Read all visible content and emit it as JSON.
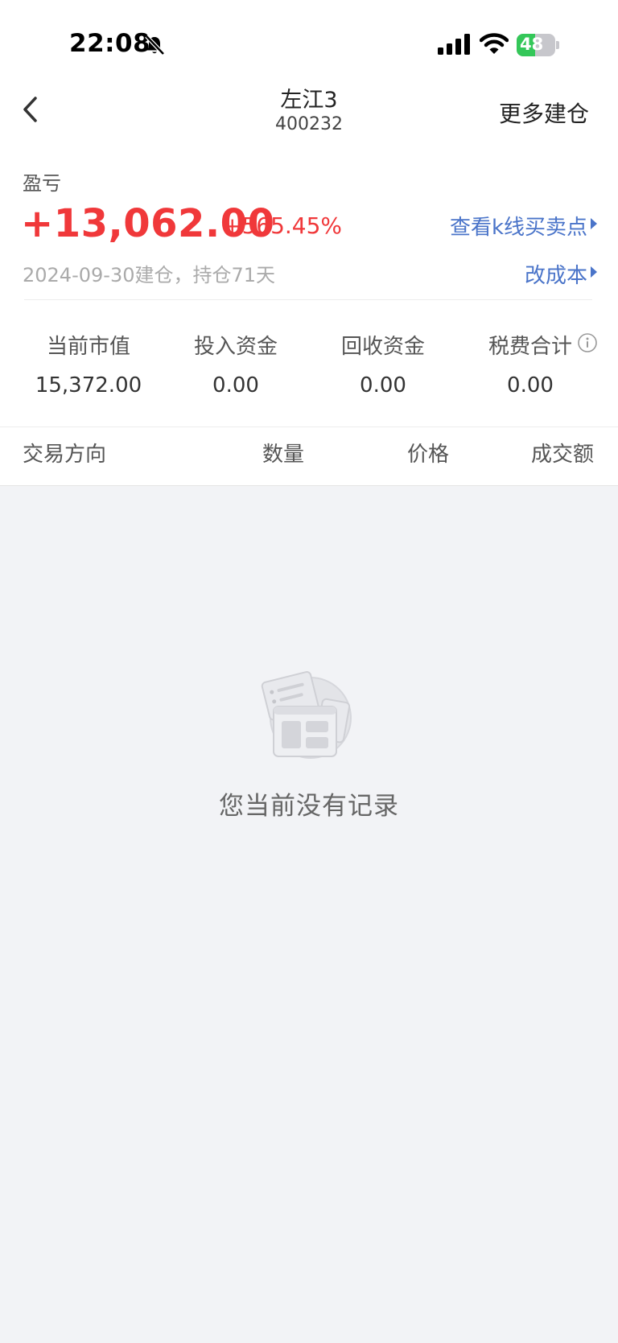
{
  "status_bar": {
    "time": "22:08",
    "battery": "48",
    "battery_level": 0.48
  },
  "nav": {
    "title": "左江3",
    "code": "400232",
    "more": "更多建仓"
  },
  "pnl": {
    "label": "盈亏",
    "value": "+13,062.00",
    "percent": "+565.45%",
    "kline_link": "查看k线买卖点",
    "date_info": "2024-09-30建仓，持仓71天",
    "cost_link": "改成本"
  },
  "stats": [
    {
      "label": "当前市值",
      "value": "15,372.00"
    },
    {
      "label": "投入资金",
      "value": "0.00"
    },
    {
      "label": "回收资金",
      "value": "0.00"
    },
    {
      "label": "税费合计",
      "value": "0.00"
    }
  ],
  "table_header": [
    "交易方向",
    "数量",
    "价格",
    "成交额"
  ],
  "empty": {
    "text": "您当前没有记录"
  },
  "colors": {
    "profit": "#f0383a",
    "link": "#4a74c9",
    "background": "#f2f3f6"
  }
}
